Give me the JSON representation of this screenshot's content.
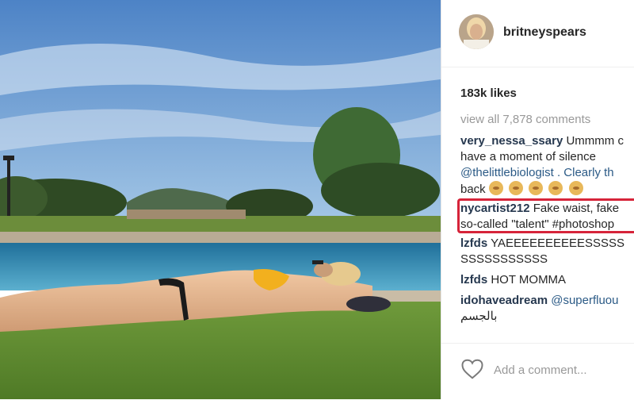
{
  "post": {
    "username": "britneyspears",
    "likes": "183k likes",
    "view_all": "view all 7,878 comments",
    "comments": [
      {
        "user": "very_nessa_ssary",
        "lines": [
          "Ummmm c",
          "have a moment of silence",
          "@thelittlebiologist . Clearly th",
          "back"
        ],
        "emoji_count": 5
      },
      {
        "user": "nycartist212",
        "lines": [
          "Fake waist, fake",
          "so-called \"talent\" #photoshop"
        ],
        "highlighted": true
      },
      {
        "user": "lzfds",
        "lines": [
          "YAEEEEEEEEEESSSSS",
          "SSSSSSSSSSS"
        ]
      },
      {
        "user": "lzfds",
        "lines": [
          "HOT MOMMA"
        ]
      },
      {
        "user": "idohaveadream",
        "lines": [
          "@superfluou",
          "بالجسم"
        ]
      }
    ],
    "add_comment_placeholder": "Add a comment..."
  },
  "colors": {
    "highlight_border": "#d6243a",
    "username_color": "#26384f",
    "link_color": "#2b5a86"
  },
  "icons": {
    "like": "heart-icon"
  }
}
